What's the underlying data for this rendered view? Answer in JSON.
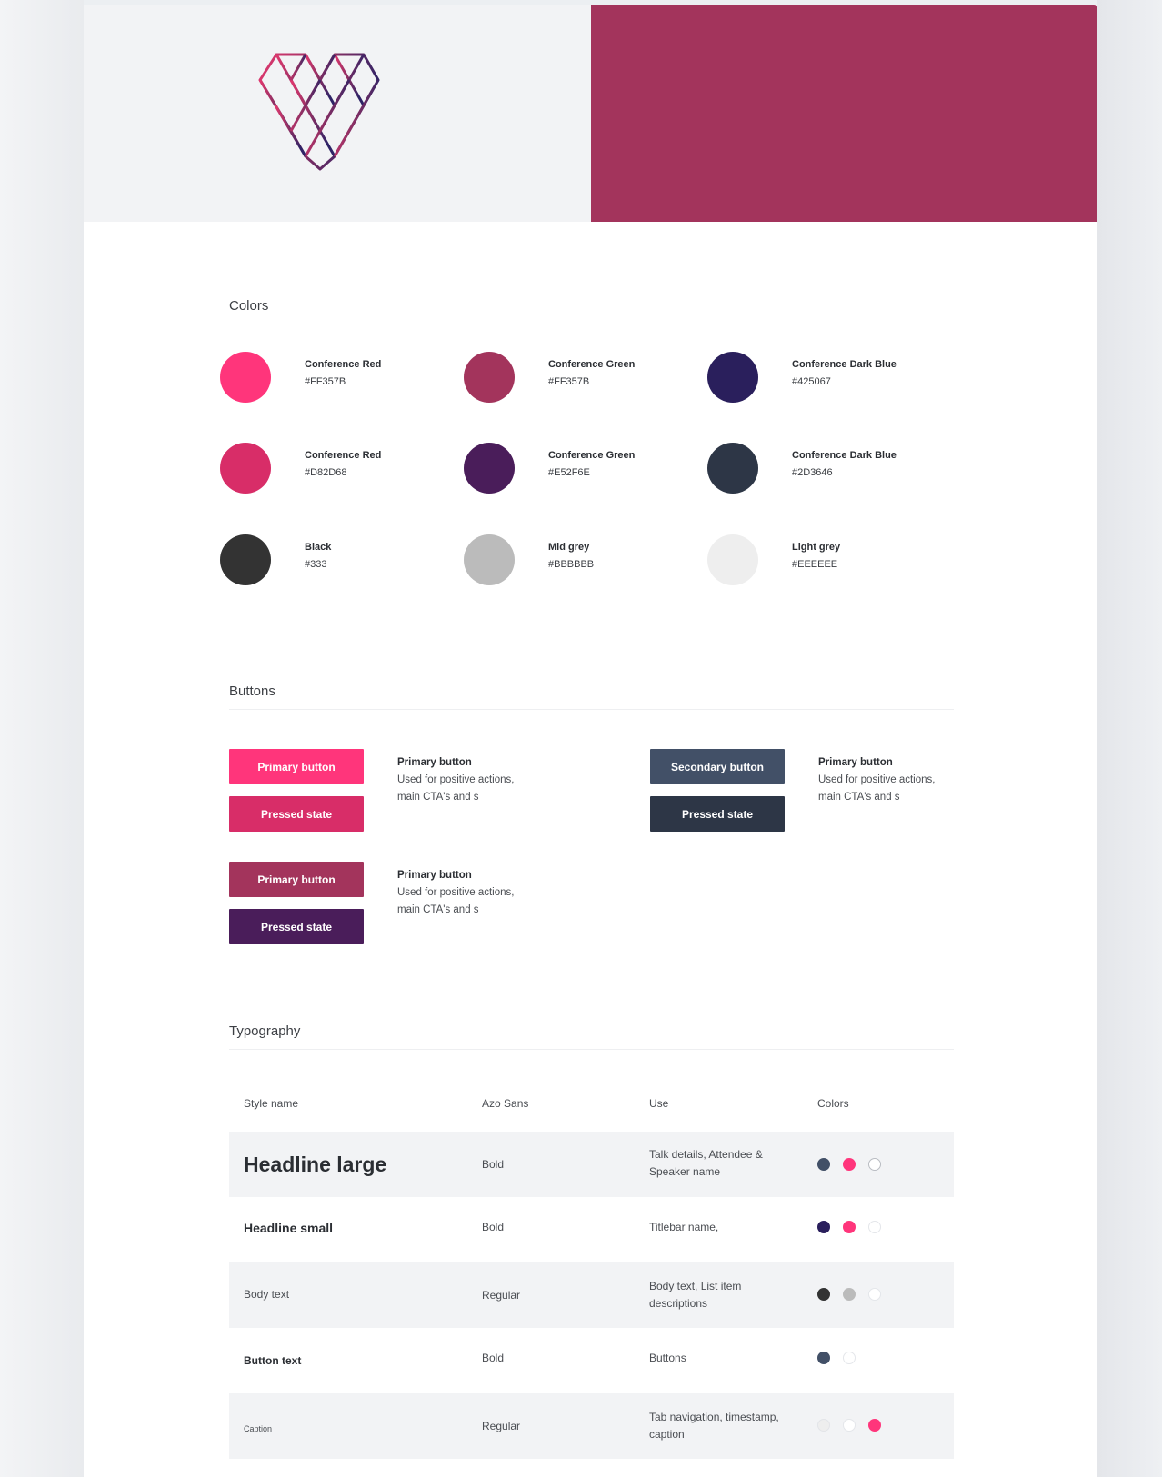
{
  "hero": {
    "logo": "geometric-heart-logo",
    "brand_color": "#a3345c"
  },
  "colors": {
    "title": "Colors",
    "swatches": [
      {
        "name": "Conference Red",
        "hex": "#FF357B",
        "color": "#ff357b"
      },
      {
        "name": "Conference Green",
        "hex": "#FF357B",
        "color": "#a3345c"
      },
      {
        "name": "Conference Dark Blue",
        "hex": "#425067",
        "color": "#2a1f5c"
      },
      {
        "name": "Conference Red",
        "hex": "#D82D68",
        "color": "#d82d68"
      },
      {
        "name": "Conference Green",
        "hex": "#E52F6E",
        "color": "#4a1d5a"
      },
      {
        "name": "Conference Dark Blue",
        "hex": "#2D3646",
        "color": "#2d3646"
      },
      {
        "name": "Black",
        "hex": "#333",
        "color": "#333333"
      },
      {
        "name": "Mid grey",
        "hex": "#BBBBBB",
        "color": "#bbbbbb"
      },
      {
        "name": "Light grey",
        "hex": "#EEEEEE",
        "color": "#eeeeee"
      }
    ]
  },
  "buttons": {
    "title": "Buttons",
    "groups": [
      {
        "main_label": "Primary button",
        "main_color": "#ff357b",
        "pressed_label": "Pressed state",
        "pressed_color": "#d82d68",
        "desc_title": "Primary button",
        "desc_line1": "Used for positive actions,",
        "desc_line2": "main CTA's and s"
      },
      {
        "main_label": "Secondary button",
        "main_color": "#425067",
        "pressed_label": "Pressed state",
        "pressed_color": "#2d3646",
        "desc_title": "Primary button",
        "desc_line1": "Used for positive actions,",
        "desc_line2": "main CTA's and s"
      },
      {
        "main_label": "Primary button",
        "main_color": "#a3345c",
        "pressed_label": "Pressed state",
        "pressed_color": "#4a1d5a",
        "desc_title": "Primary button",
        "desc_line1": "Used for positive actions,",
        "desc_line2": "main CTA's and s"
      }
    ]
  },
  "typography": {
    "title": "Typography",
    "headers": [
      "Style name",
      "Azo Sans",
      "Use",
      "Colors"
    ],
    "rows": [
      {
        "style": "Headline large",
        "weight": "Bold",
        "use1": "Talk details, Attendee &",
        "use2": "Speaker name",
        "colors": [
          "#425067",
          "#ff357b",
          "#ffffff"
        ]
      },
      {
        "style": "Headline small",
        "weight": "Bold",
        "use1": "Titlebar name,",
        "use2": "",
        "colors": [
          "#2a1f5c",
          "#ff357b",
          "#ffffff"
        ]
      },
      {
        "style": "Body text",
        "weight": "Regular",
        "use1": "Body text, List item",
        "use2": "descriptions",
        "colors": [
          "#333333",
          "#bbbbbb",
          "#ffffff"
        ]
      },
      {
        "style": "Button text",
        "weight": "Bold",
        "use1": "Buttons",
        "use2": "",
        "colors": [
          "#425067",
          "#ffffff"
        ]
      },
      {
        "style": "Caption",
        "weight": "Regular",
        "use1": "Tab navigation, timestamp,",
        "use2": "caption",
        "colors": [
          "#eeeeee",
          "#ffffff",
          "#ff357b"
        ]
      }
    ]
  }
}
